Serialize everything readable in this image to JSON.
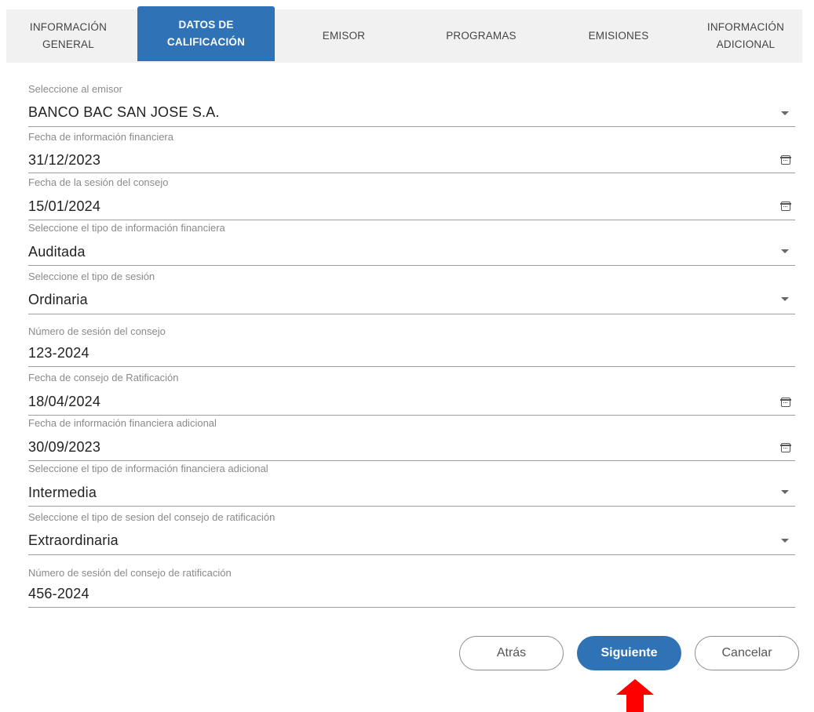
{
  "tabs": [
    {
      "label": "INFORMACIÓN\nGENERAL"
    },
    {
      "label": "DATOS DE\nCALIFICACIÓN"
    },
    {
      "label": "EMISOR"
    },
    {
      "label": "PROGRAMAS"
    },
    {
      "label": "EMISIONES"
    },
    {
      "label": "INFORMACIÓN\nADICIONAL"
    }
  ],
  "form": {
    "fields": [
      {
        "label": "Seleccione al emisor",
        "value": "BANCO BAC SAN JOSE S.A.",
        "icon": "chevron-down-icon"
      },
      {
        "label": "Fecha de información financiera",
        "value": "31/12/2023",
        "icon": "calendar-icon"
      },
      {
        "label": "Fecha de la sesión del consejo",
        "value": "15/01/2024",
        "icon": "calendar-icon"
      },
      {
        "label": "Seleccione el tipo de información financiera",
        "value": "Auditada",
        "icon": "chevron-down-icon"
      },
      {
        "label": "Seleccione el tipo de sesión",
        "value": "Ordinaria",
        "icon": "chevron-down-icon"
      },
      {
        "label": "Número de sesión del consejo",
        "value": "123-2024"
      },
      {
        "label": "Fecha de consejo de Ratificación",
        "value": "18/04/2024",
        "icon": "calendar-icon"
      },
      {
        "label": "Fecha de información financiera adicional",
        "value": "30/09/2023",
        "icon": "calendar-icon"
      },
      {
        "label": "Seleccione el tipo de información financiera adicional",
        "value": "Intermedia",
        "icon": "chevron-down-icon"
      },
      {
        "label": "Seleccione el tipo de sesion del consejo de ratificación",
        "value": "Extraordinaria",
        "icon": "chevron-down-icon"
      },
      {
        "label": "Número de sesión del consejo de ratificación",
        "value": "456-2024"
      }
    ]
  },
  "buttons": {
    "back": "Atrás",
    "next": "Siguiente",
    "cancel": "Cancelar"
  },
  "colors": {
    "accent": "#2f73b6",
    "arrow": "#ff0000"
  }
}
